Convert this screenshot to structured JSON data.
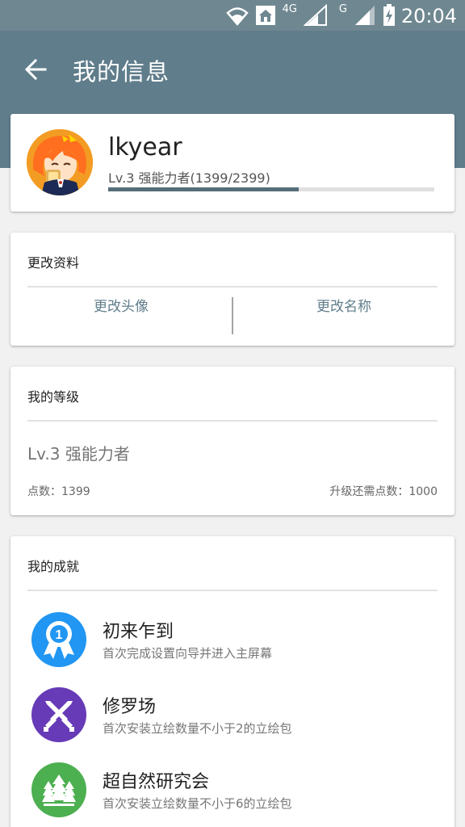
{
  "status_bar": {
    "time": "20:04",
    "network_4g": "4G",
    "network_g": "G",
    "icons": [
      "wifi-icon",
      "home-icon",
      "signal-icon",
      "signal-icon",
      "battery-charging-icon"
    ]
  },
  "app_bar": {
    "title": "我的信息",
    "back_icon": "arrow-left-icon",
    "color": "#607d8b"
  },
  "profile": {
    "username": "lkyear",
    "level_text": "Lv.3 强能力者(1399/2399)",
    "progress_fraction": 0.583
  },
  "edit_profile": {
    "title": "更改资料",
    "change_avatar": "更改头像",
    "change_name": "更改名称"
  },
  "my_level": {
    "title": "我的等级",
    "level_name": "Lv.3 强能力者",
    "points": "点数：1399",
    "points_needed": "升级还需点数：1000"
  },
  "achievements": {
    "title": "我的成就",
    "items": [
      {
        "name": "初来乍到",
        "desc": "首次完成设置向导并进入主屏幕",
        "icon": "first-badge-icon",
        "color": "#2196f3"
      },
      {
        "name": "修罗场",
        "desc": "首次安装立绘数量不小于2的立绘包",
        "icon": "crossed-swords-icon",
        "color": "#673ab7"
      },
      {
        "name": "超自然研究会",
        "desc": "首次安装立绘数量不小于6的立绘包",
        "icon": "forest-icon",
        "color": "#4caf50"
      }
    ]
  }
}
